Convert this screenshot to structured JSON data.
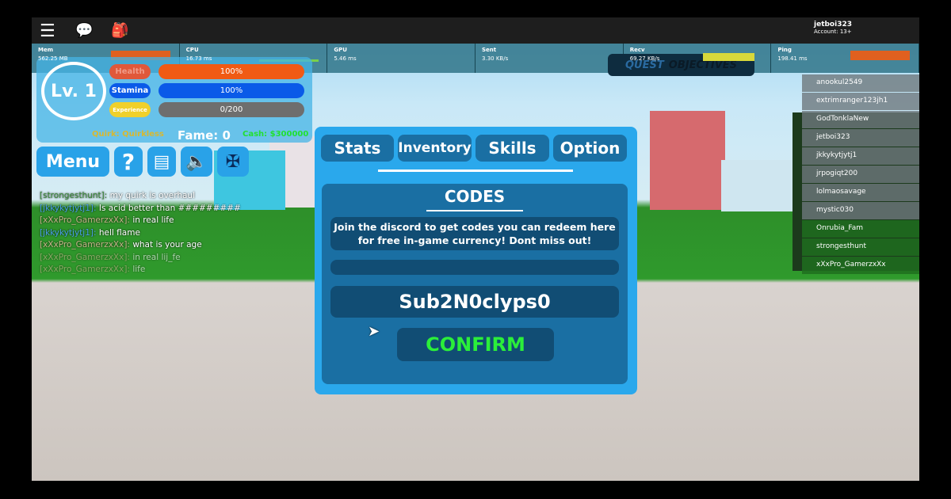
{
  "topbar": {
    "username": "jetboi323",
    "account": "Account: 13+",
    "icons": [
      "menu-icon",
      "chat-icon",
      "backpack-icon"
    ]
  },
  "stats": [
    {
      "label": "Mem",
      "value": "562.25 MB"
    },
    {
      "label": "CPU",
      "value": "16.73 ms"
    },
    {
      "label": "GPU",
      "value": "5.46 ms"
    },
    {
      "label": "Sent",
      "value": "3.30 KB/s"
    },
    {
      "label": "Recv",
      "value": "69.27 KB/s"
    },
    {
      "label": "Ping",
      "value": "198.41 ms"
    }
  ],
  "quest": {
    "left": "QUEST",
    "right": "OBJECTIVES"
  },
  "hud": {
    "level": "Lv. 1",
    "health_label": "Health",
    "health": "100%",
    "stamina_label": "Stamina",
    "stamina": "100%",
    "exp_label": "Experience",
    "exp": "0/200",
    "quirk": "Quirk: Quirkless",
    "fame": "Fame: 0",
    "cash": "Cash: $300000",
    "menu": "Menu",
    "colors": {
      "health": "#f05a14",
      "stamina": "#0a5ae8",
      "exp": "#6e6e6e"
    }
  },
  "chat": [
    {
      "name": "[strongesthunt]:",
      "msg": "my quirk is overhaul",
      "c": "n1"
    },
    {
      "name": "[jkkykytjytj1]:",
      "msg": "Is acid better than #########",
      "c": "n2"
    },
    {
      "name": "[xXxPro_GamerzxXx]:",
      "msg": "in real life",
      "c": "n3"
    },
    {
      "name": "[jkkykytjytj1]:",
      "msg": "hell flame",
      "c": "n2"
    },
    {
      "name": "[xXxPro_GamerzxXx]:",
      "msg": "what is your age",
      "c": "n3"
    },
    {
      "name": "[xXxPro_GamerzxXx]:",
      "msg": "in real lij_fe",
      "c": "n3 dim"
    },
    {
      "name": "[xXxPro_GamerzxXx]:",
      "msg": "life",
      "c": "n3 dim"
    }
  ],
  "players": [
    "anookul2549",
    "extrimranger123jh1",
    "GodTonklaNew",
    "jetboi323",
    "jkkykytjytj1",
    "jrpogiqt200",
    "lolmaosavage",
    "mystic030",
    "Onrubia_Fam",
    "strongesthunt",
    "xXxPro_GamerzxXx"
  ],
  "modal": {
    "tabs": [
      "Stats",
      "Inventory",
      "Skills",
      "Option"
    ],
    "active_tab": "Inventory",
    "title": "CODES",
    "description": "Join the discord to get codes you can redeem here for free in-game currency! Dont miss out!",
    "code_value": "Sub2N0clyps0",
    "confirm": "CONFIRM"
  }
}
